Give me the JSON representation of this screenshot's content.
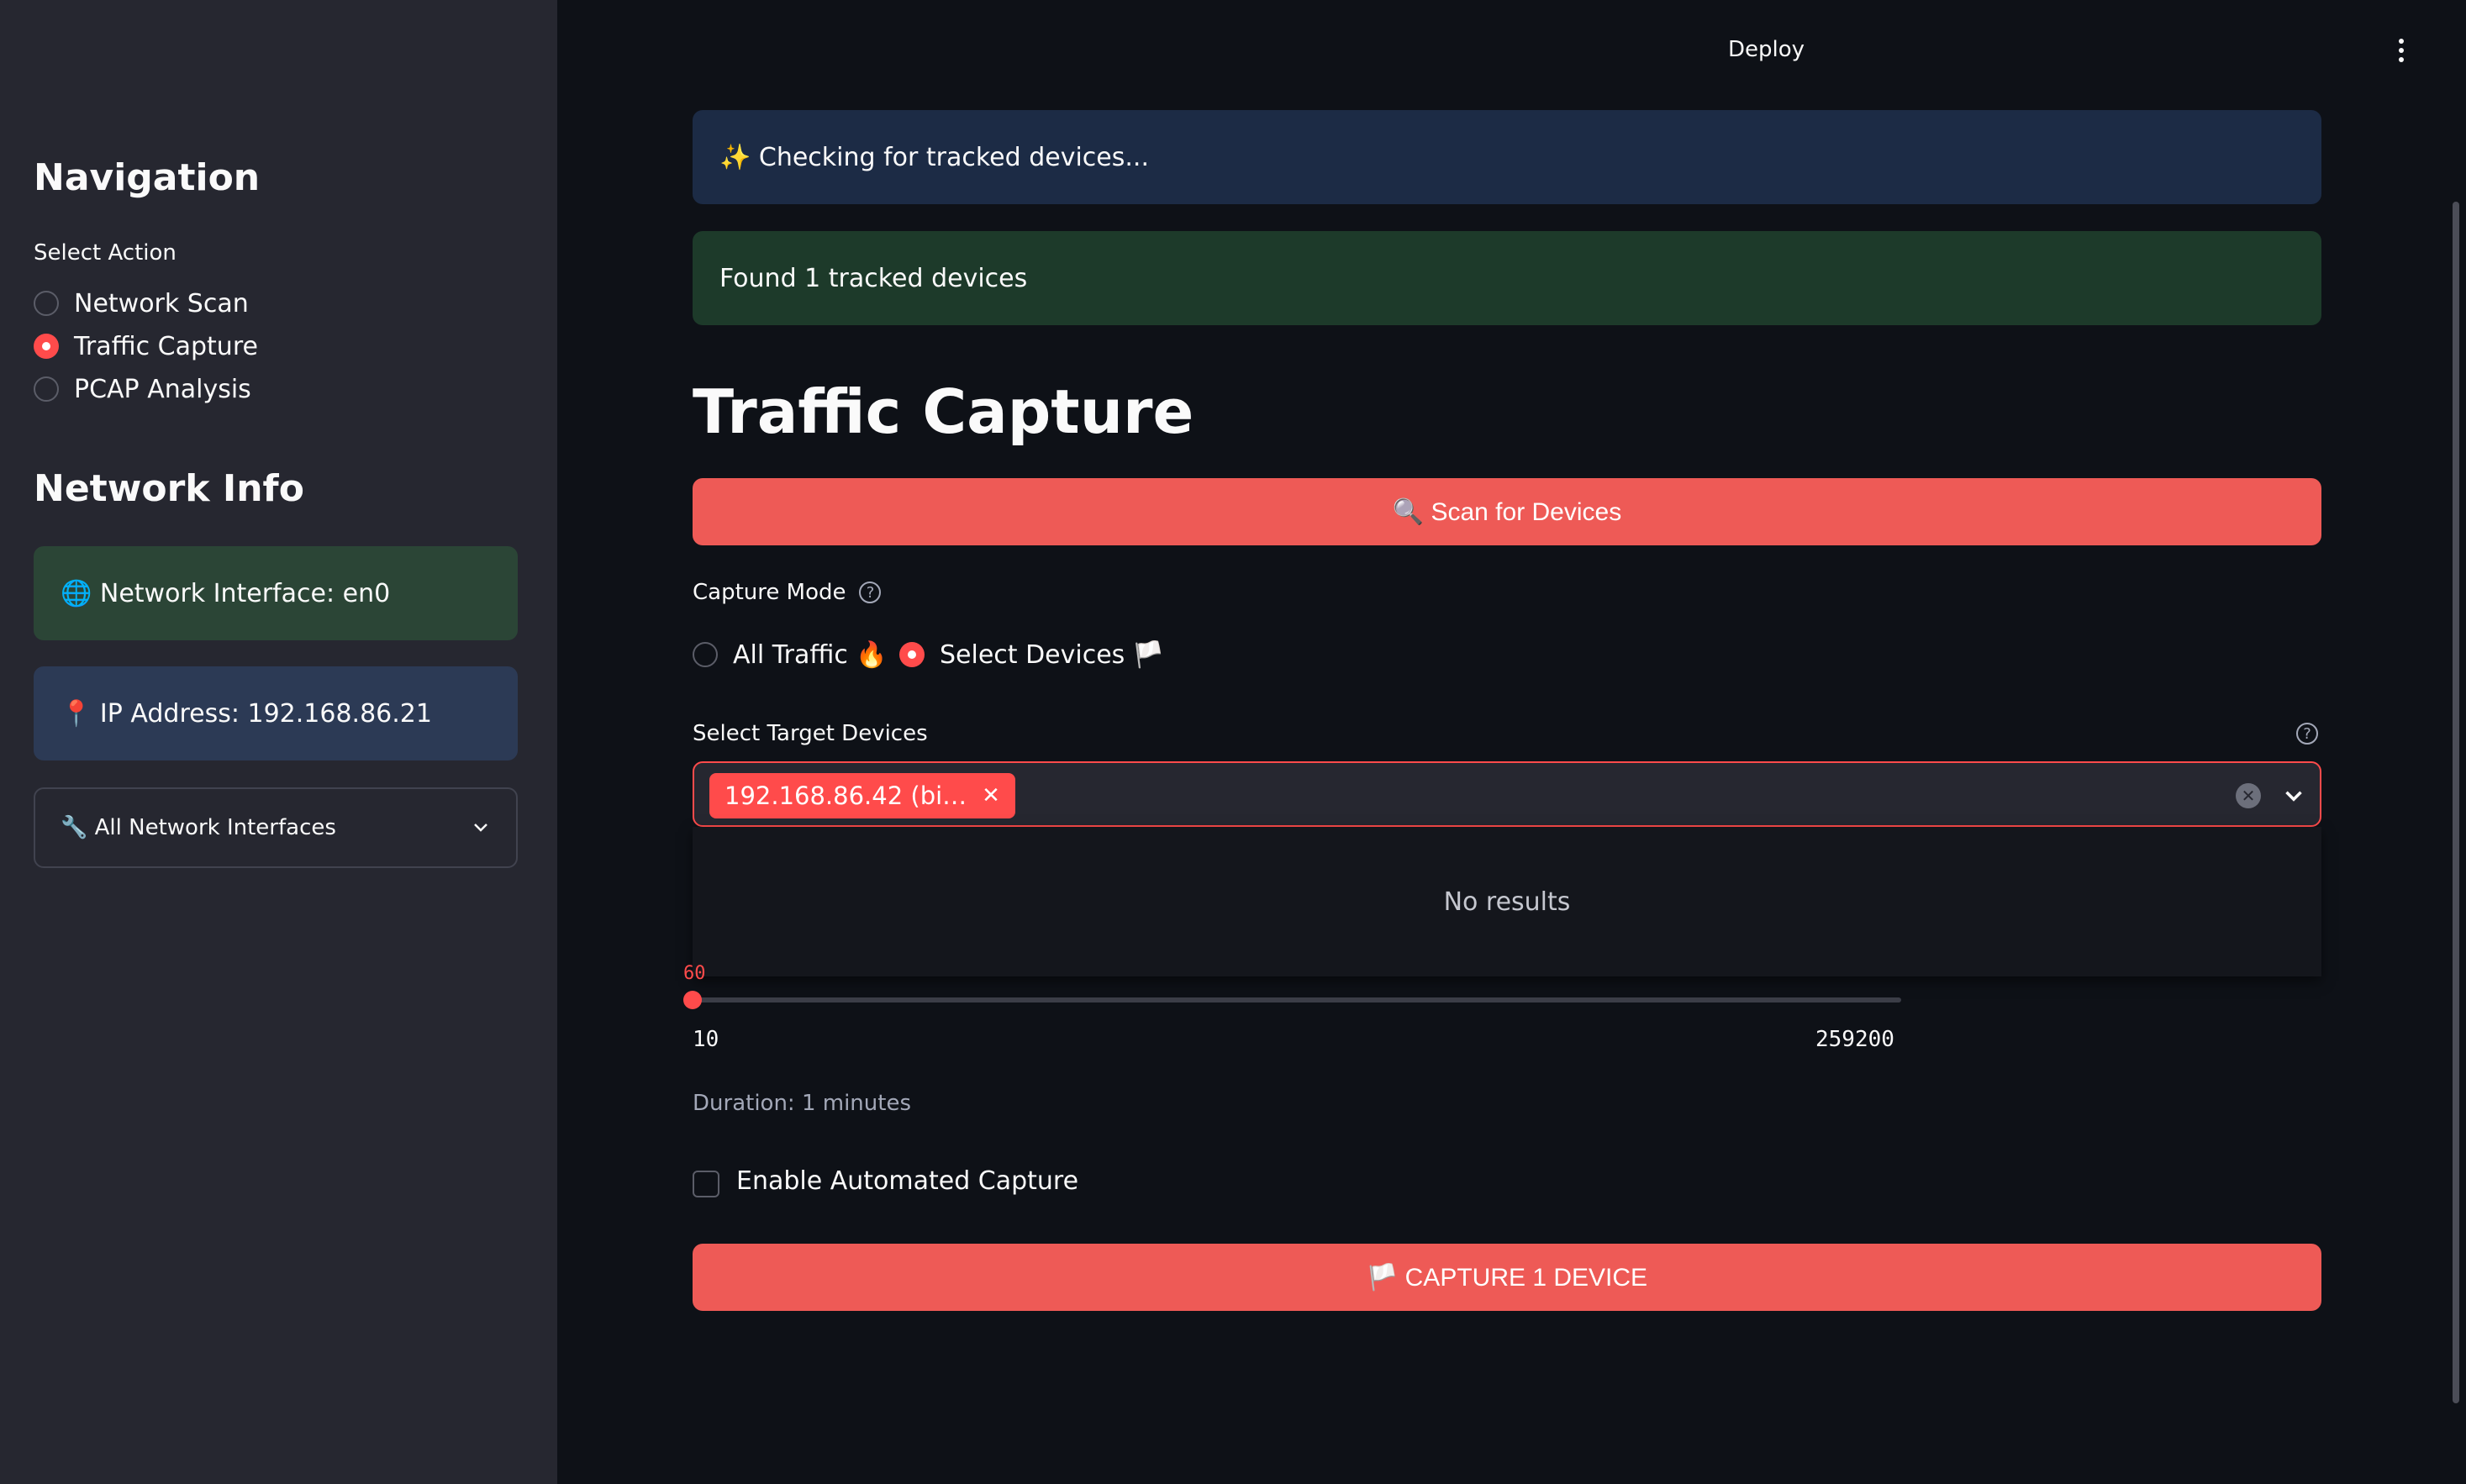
{
  "topbar": {
    "deploy_label": "Deploy"
  },
  "sidebar": {
    "nav_heading": "Navigation",
    "select_action_label": "Select Action",
    "actions": [
      {
        "label": "Network Scan",
        "selected": false
      },
      {
        "label": "Traffic Capture",
        "selected": true
      },
      {
        "label": "PCAP Analysis",
        "selected": false
      }
    ],
    "network_heading": "Network Info",
    "interface_text": "🌐 Network Interface: en0",
    "ip_text": "📍 IP Address: 192.168.86.21",
    "interfaces_expander": "🔧 All Network Interfaces"
  },
  "main": {
    "info_alert": "✨ Checking for tracked devices...",
    "success_alert": "Found 1 tracked devices",
    "title": "Traffic Capture",
    "scan_button": "🔍 Scan for Devices",
    "capture_mode_label": "Capture Mode",
    "capture_modes": [
      {
        "label": "All Traffic 🔥",
        "selected": false
      },
      {
        "label": "Select Devices 🏳️",
        "selected": true
      }
    ],
    "target_devices_label": "Select Target Devices",
    "selected_chip": "192.168.86.42 (bi…",
    "dropdown_message": "No results",
    "slider": {
      "current": "60",
      "min": "10",
      "max": "259200",
      "value": 60
    },
    "duration_caption": "Duration: 1 minutes",
    "automated_capture_label": "Enable Automated Capture",
    "automated_capture_checked": false,
    "capture_button": "🏳️ CAPTURE 1 DEVICE"
  },
  "colors": {
    "accent": "#ff4b4b",
    "button": "#ee5a56",
    "info_bg": "#1c2b45",
    "success_bg": "#1d3a2a",
    "sidebar_bg": "#262730",
    "main_bg": "#0e1117"
  }
}
